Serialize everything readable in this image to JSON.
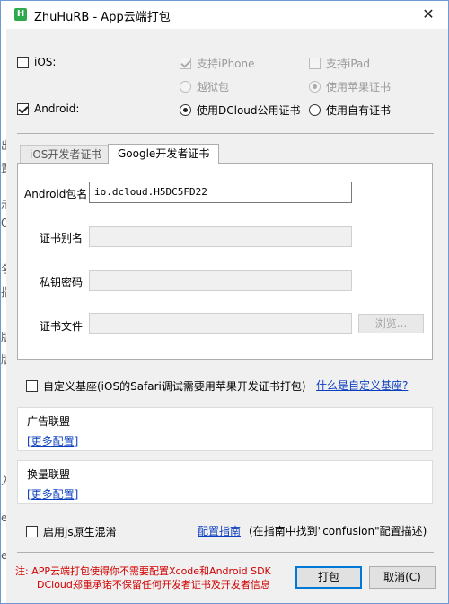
{
  "window": {
    "title": "ZhuHuRB - App云端打包",
    "icon_letter": "H",
    "close_glyph": "✕"
  },
  "left_strip": [
    "出",
    "置",
    "示",
    "O",
    "名",
    "指",
    "版",
    "版",
    "入",
    "ex",
    "ex"
  ],
  "platforms": {
    "ios": {
      "label": "iOS:",
      "checked": false
    },
    "support_iphone": {
      "label": "支持iPhone",
      "checked": true,
      "disabled": true
    },
    "support_ipad": {
      "label": "支持iPad",
      "checked": false,
      "disabled": true
    },
    "jailbreak": {
      "label": "越狱包",
      "selected": false,
      "disabled": true
    },
    "apple_cert": {
      "label": "使用苹果证书",
      "selected": true,
      "disabled": true
    },
    "android": {
      "label": "Android:",
      "checked": true
    },
    "dcloud_cert": {
      "label": "使用DCloud公用证书",
      "selected": true
    },
    "own_cert": {
      "label": "使用自有证书",
      "selected": false
    }
  },
  "tabs": [
    {
      "label": "iOS开发者证书",
      "active": false
    },
    {
      "label": "Google开发者证书",
      "active": true
    }
  ],
  "form": {
    "package_label": "Android包名",
    "package_value": "io.dcloud.H5DC5FD22",
    "alias_label": "证书别名",
    "alias_value": "",
    "password_label": "私钥密码",
    "password_value": "",
    "file_label": "证书文件",
    "file_value": "",
    "browse_label": "浏览..."
  },
  "custom_base": {
    "label": "自定义基座(iOS的Safari调试需要用苹果开发证书打包)",
    "checked": false,
    "link": "什么是自定义基座?"
  },
  "ad_union": {
    "title": "广告联盟",
    "link": "[更多配置]"
  },
  "exchange_union": {
    "title": "换量联盟",
    "link": "[更多配置]"
  },
  "obfuscation": {
    "label": "启用js原生混淆",
    "checked": false,
    "guide_link": "配置指南",
    "guide_text": "(在指南中找到\"confusion\"配置描述)"
  },
  "footer": {
    "note_line1": "注: APP云端打包使得你不需要配置Xcode和Android SDK",
    "note_line2": "DCloud郑重承诺不保留任何开发者证书及开发者信息",
    "pack_button": "打包",
    "cancel_button": "取消(C)"
  }
}
